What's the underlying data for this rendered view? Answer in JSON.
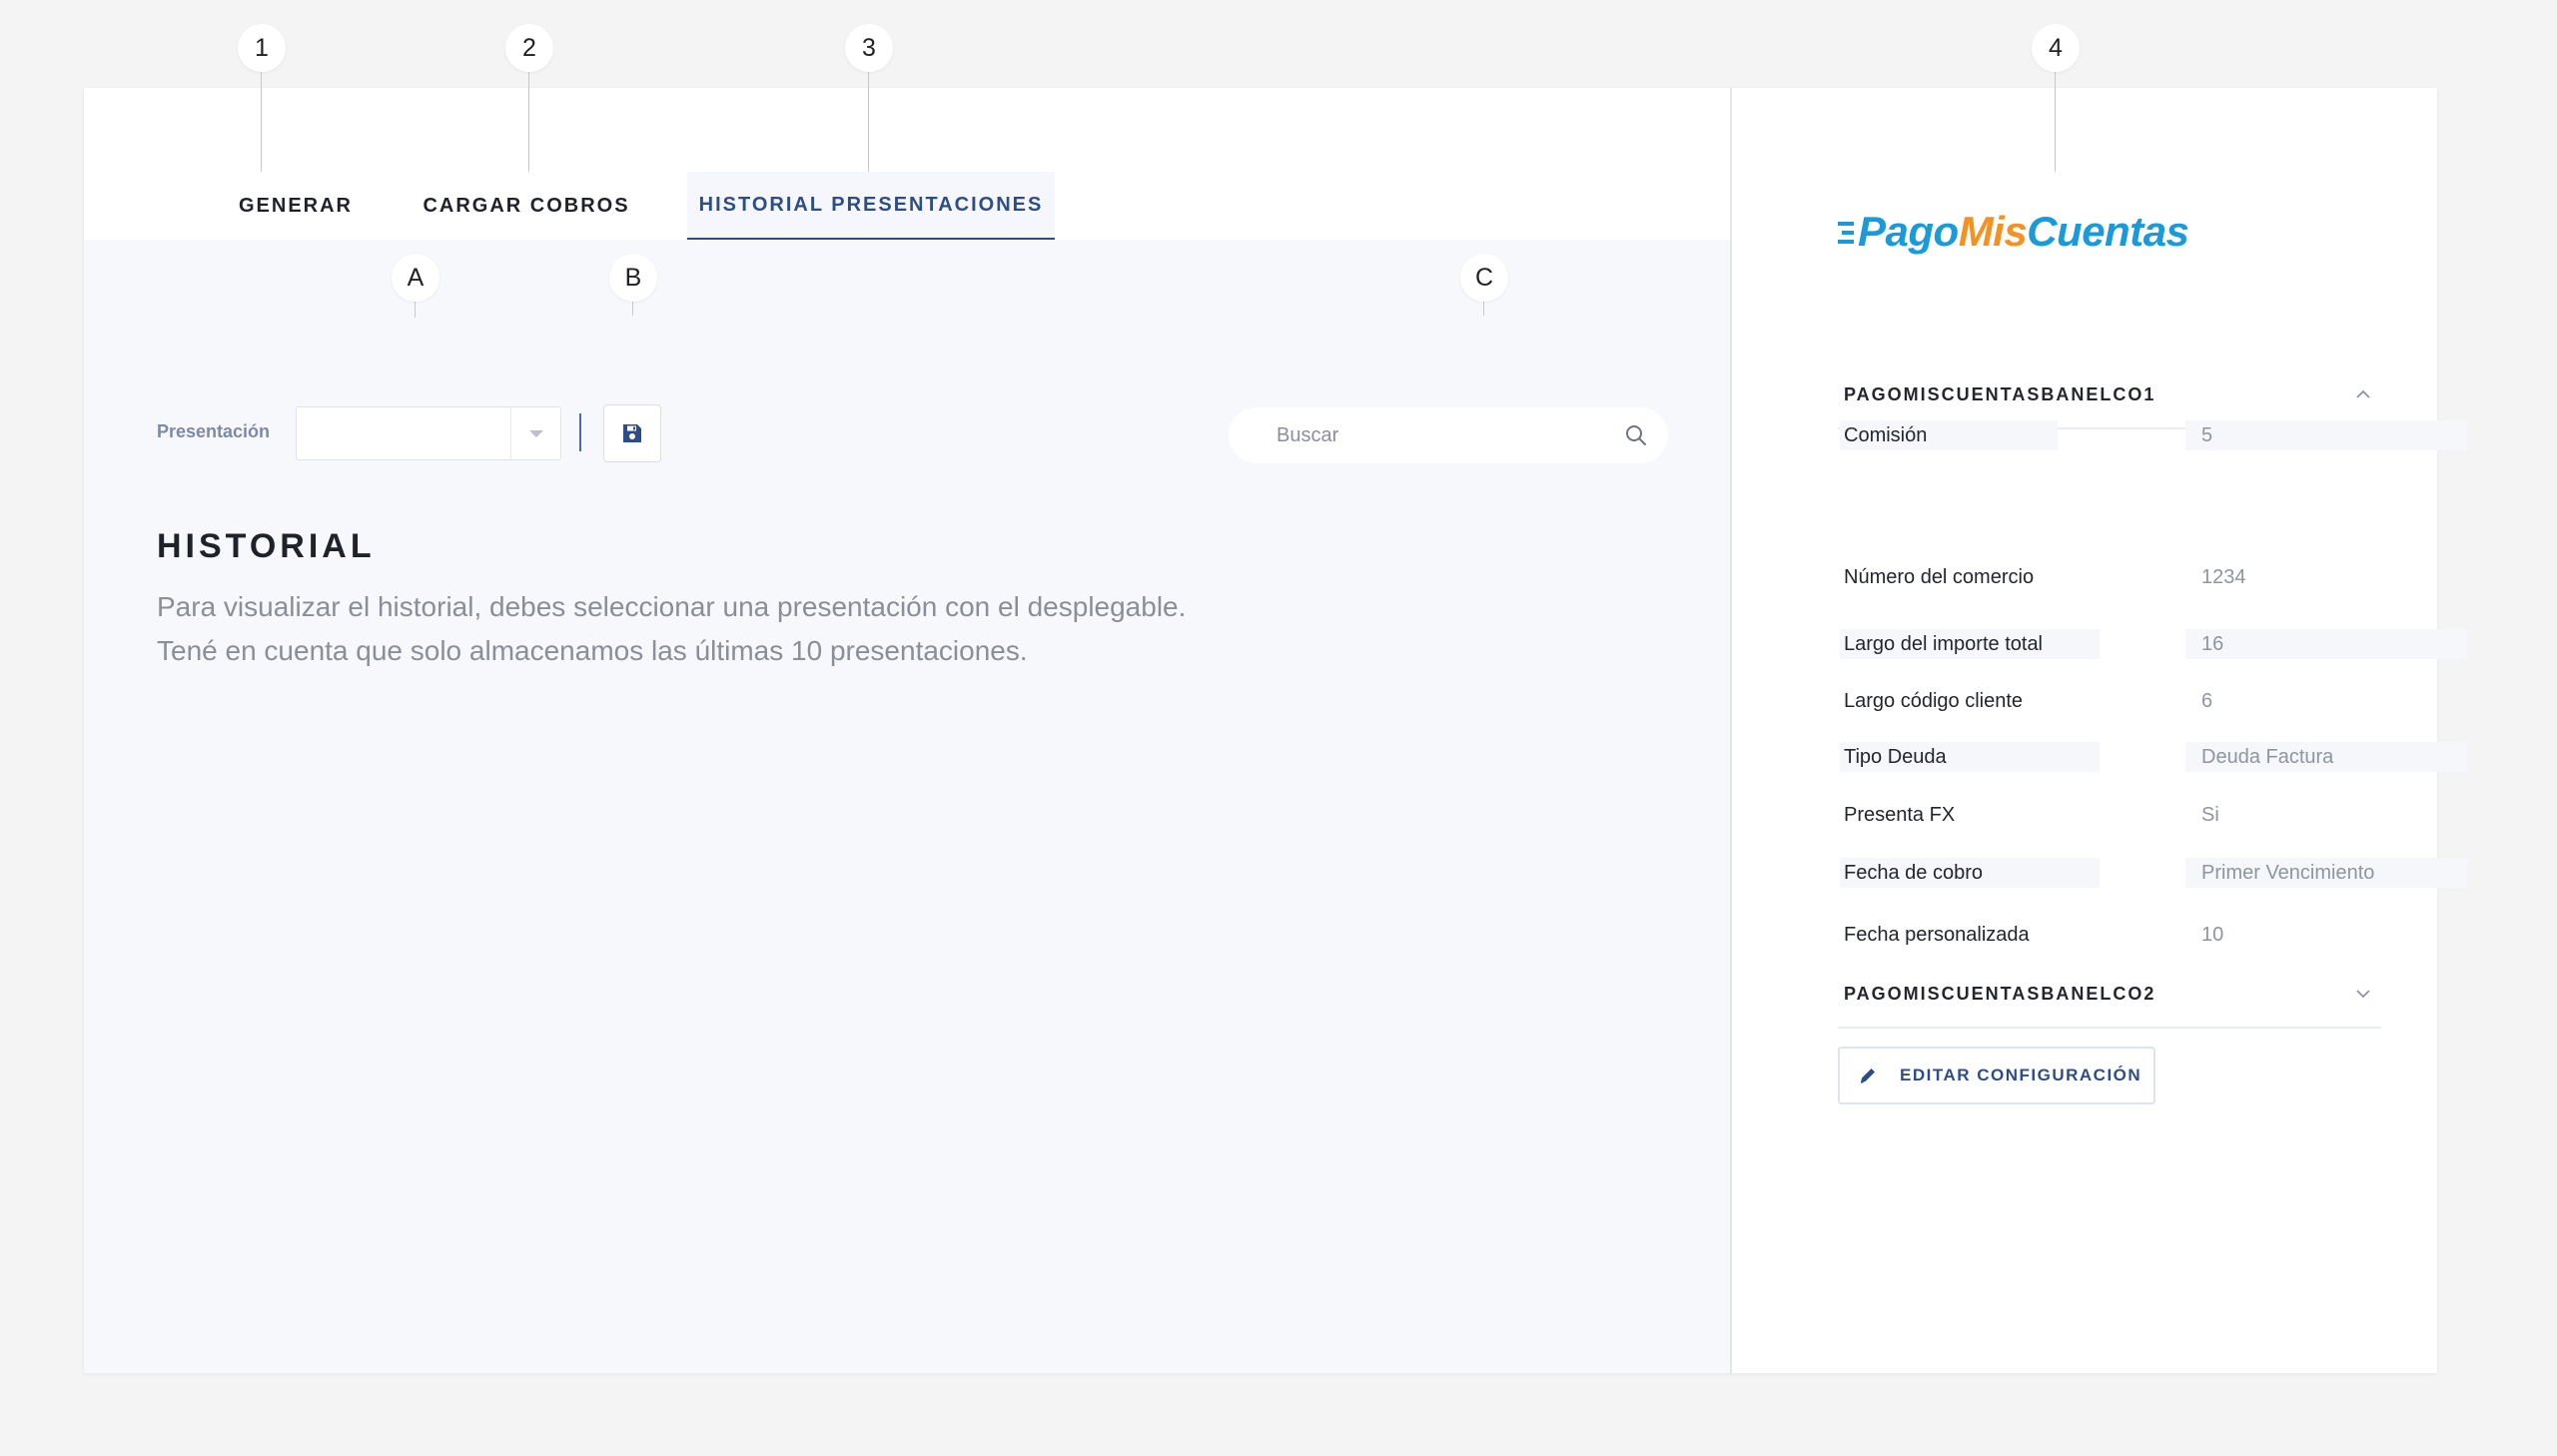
{
  "callouts": [
    "1",
    "2",
    "3",
    "4",
    "A",
    "B",
    "C"
  ],
  "tabs": [
    {
      "label": "GENERAR"
    },
    {
      "label": "CARGAR COBROS"
    },
    {
      "label": "HISTORIAL PRESENTACIONES",
      "active": true
    }
  ],
  "toolbar": {
    "presentacion_label": "Presentación",
    "select_value": "",
    "search_placeholder": "Buscar"
  },
  "historial": {
    "title": "HISTORIAL",
    "line1": "Para visualizar el historial, debes seleccionar una presentación con el desplegable.",
    "line2": "Tené en cuenta que solo almacenamos las últimas 10 presentaciones."
  },
  "brand": {
    "name_part1": "Pago",
    "name_part2": "Mis",
    "name_part3": "Cuentas",
    "colors": {
      "blue": "#1a9ad8",
      "orange": "#f39223"
    }
  },
  "sections": [
    {
      "title": "PAGOMISCUENTASBANELCO1",
      "expanded": true,
      "fields": [
        {
          "label": "Comisión",
          "value": "5"
        },
        {
          "label": "Número del comercio",
          "value": "1234"
        },
        {
          "label": "Largo del importe total",
          "value": "16"
        },
        {
          "label": "Largo código cliente",
          "value": "6"
        },
        {
          "label": "Tipo Deuda",
          "value": "Deuda Factura"
        },
        {
          "label": "Presenta FX",
          "value": "Si"
        },
        {
          "label": "Fecha de cobro",
          "value": "Primer Vencimiento"
        },
        {
          "label": "Fecha personalizada",
          "value": "10"
        }
      ]
    },
    {
      "title": "PAGOMISCUENTASBANELCO2",
      "expanded": false,
      "fields": []
    }
  ],
  "edit_button": {
    "label": "EDITAR CONFIGURACIÓN"
  },
  "accent_color": "#2d4d86"
}
